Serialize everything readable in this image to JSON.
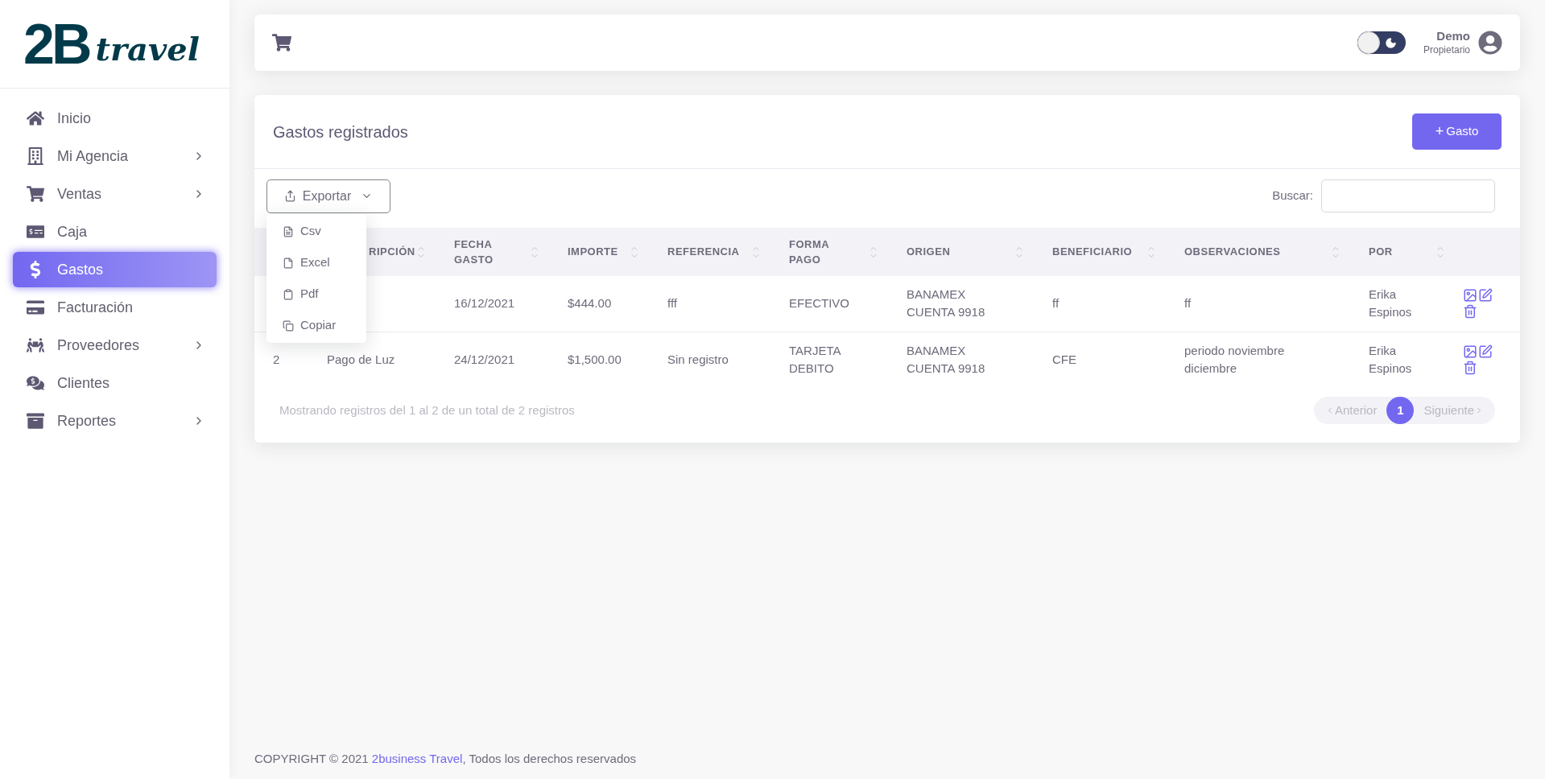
{
  "logo": {
    "mark": "2B",
    "word": "travel"
  },
  "sidebar": {
    "items": [
      {
        "label": "Inicio",
        "selected": false,
        "expandable": false
      },
      {
        "label": "Mi Agencia",
        "selected": false,
        "expandable": true
      },
      {
        "label": "Ventas",
        "selected": false,
        "expandable": true
      },
      {
        "label": "Caja",
        "selected": false,
        "expandable": false
      },
      {
        "label": "Gastos",
        "selected": true,
        "expandable": false
      },
      {
        "label": "Facturación",
        "selected": false,
        "expandable": false
      },
      {
        "label": "Proveedores",
        "selected": false,
        "expandable": true
      },
      {
        "label": "Clientes",
        "selected": false,
        "expandable": false
      },
      {
        "label": "Reportes",
        "selected": false,
        "expandable": true
      }
    ]
  },
  "topbar": {
    "dark_mode": false,
    "user": {
      "name": "Demo",
      "role": "Propietario"
    }
  },
  "card": {
    "title": "Gastos registrados",
    "add_button": "Gasto",
    "add_symbol": "+",
    "export_button": "Exportar",
    "export_menu": [
      "Csv",
      "Excel",
      "Pdf",
      "Copiar"
    ],
    "search": {
      "label": "Buscar:"
    },
    "table": {
      "columns": [
        null,
        "RIPCIÓN",
        "FECHA GASTO",
        "IMPORTE",
        "REFERENCIA",
        "FORMA PAGO",
        "ORIGEN",
        "BENEFICIARIO",
        "OBSERVACIONES",
        "POR"
      ],
      "rows": [
        {
          "cells": [
            null,
            null,
            "16/12/2021",
            "$444.00",
            "fff",
            "EFECTIVO",
            "BANAMEX CUENTA 9918",
            "ff",
            "ff",
            "Erika Espinos"
          ]
        },
        {
          "cells": [
            "2",
            "Pago de Luz",
            "24/12/2021",
            "$1,500.00",
            "Sin registro",
            "TARJETA DEBITO",
            "BANAMEX CUENTA 9918",
            "CFE",
            "periodo noviembre diciembre",
            "Erika Espinos"
          ]
        }
      ]
    },
    "info": "Mostrando registros del 1 al 2 de un total de 2 registros",
    "pagination": {
      "previous": {
        "label": "Anterior",
        "disabled": true
      },
      "pages": [
        {
          "label": "1",
          "selected": true
        }
      ],
      "next": {
        "label": "Siguiente",
        "disabled": true
      }
    }
  },
  "footer": {
    "prefix": "COPYRIGHT © 2021 ",
    "link": "2business Travel",
    "suffix": ", Todos los derechos reservados"
  }
}
